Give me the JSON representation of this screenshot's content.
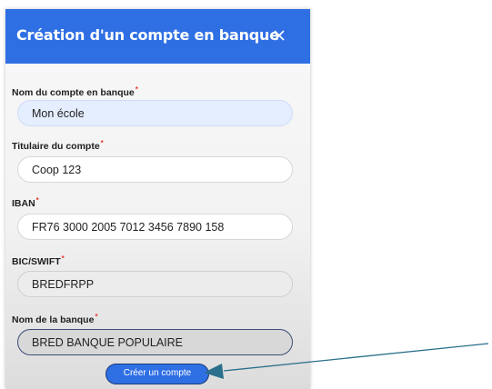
{
  "dialog": {
    "title": "Création d'un compte en banque",
    "close_icon": "close-icon",
    "header_color": "#2f6fe4"
  },
  "fields": [
    {
      "label": "Nom du compte en banque",
      "required": "*",
      "value": "Mon école"
    },
    {
      "label": "Titulaire du compte",
      "required": "*",
      "value": "Coop 123"
    },
    {
      "label": "IBAN",
      "required": "*",
      "value": "FR76 3000 2005 7012 3456 7890 158"
    },
    {
      "label": "BIC/SWIFT",
      "required": "*",
      "value": "BREDFRPP"
    },
    {
      "label": "Nom de la banque",
      "required": "*",
      "value": "BRED BANQUE POPULAIRE"
    }
  ],
  "submit": {
    "label": "Créer un compte"
  },
  "annotation": {
    "arrow_color": "#2a6f8c"
  }
}
